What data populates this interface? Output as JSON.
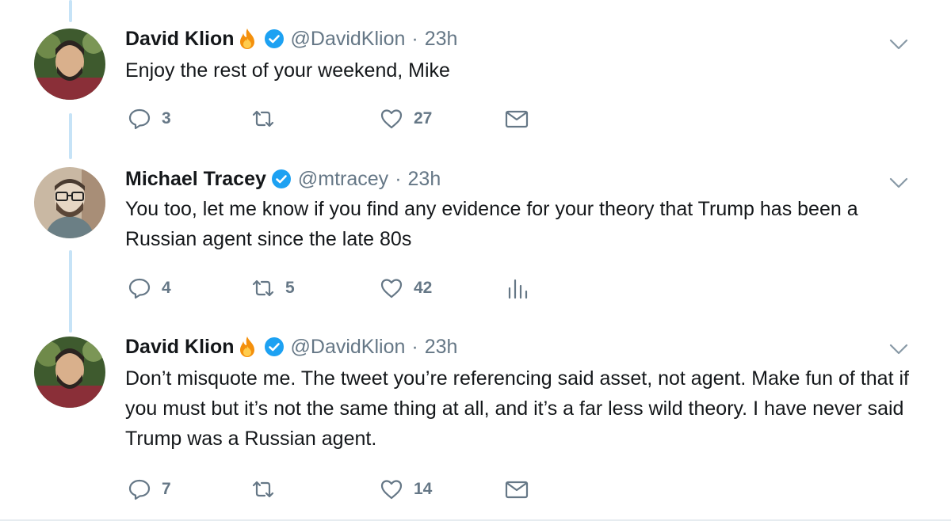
{
  "tweets": [
    {
      "name": "David Klion",
      "handle": "@DavidKlion",
      "separator": "·",
      "time": "23h",
      "has_fire_emoji": true,
      "verified": true,
      "text": "Enjoy the rest of your weekend, Mike",
      "actions": {
        "reply_count": "3",
        "retweet_count": "",
        "like_count": "27",
        "last_icon": "envelope-icon"
      }
    },
    {
      "name": "Michael Tracey",
      "handle": "@mtracey",
      "separator": "·",
      "time": "23h",
      "has_fire_emoji": false,
      "verified": true,
      "text": "You too, let me know if you find any evidence for your theory that Trump has been a Russian agent since the late 80s",
      "actions": {
        "reply_count": "4",
        "retweet_count": "5",
        "like_count": "42",
        "last_icon": "analytics-icon"
      }
    },
    {
      "name": "David Klion",
      "handle": "@DavidKlion",
      "separator": "·",
      "time": "23h",
      "has_fire_emoji": true,
      "verified": true,
      "text": "Don’t misquote me. The tweet you’re referencing said asset, not agent. Make fun of that if you must but it’s not the same thing at all, and it’s a far less wild theory. I have never said Trump was a Russian agent.",
      "actions": {
        "reply_count": "7",
        "retweet_count": "",
        "like_count": "14",
        "last_icon": "envelope-icon"
      }
    }
  ],
  "colors": {
    "thread_line": "#c6e3f7",
    "verified": "#1da1f2",
    "meta_gray": "#657786",
    "text": "#14171a"
  }
}
